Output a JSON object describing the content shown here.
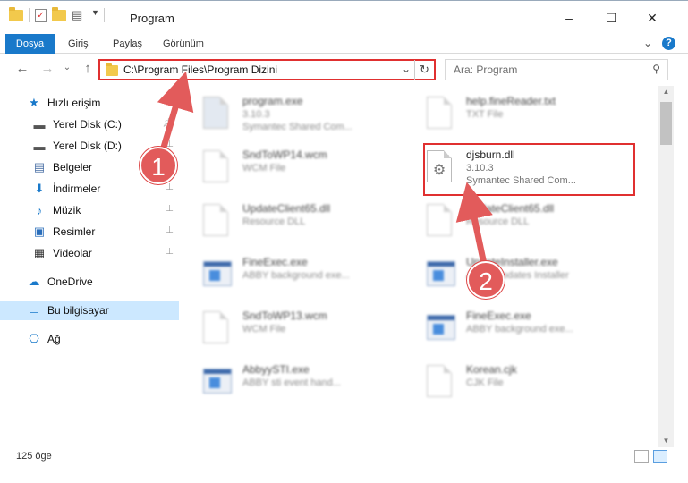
{
  "window": {
    "title": "Program",
    "minimize": "–",
    "maximize": "☐",
    "close": "✕"
  },
  "ribbon": {
    "tabs": [
      "Dosya",
      "Giriş",
      "Paylaş",
      "Görünüm"
    ],
    "help": "?",
    "collapse": "⌄"
  },
  "address": {
    "path": "C:\\Program Files\\Program Dizini",
    "dropdown": "⌄",
    "refresh": "↻"
  },
  "search": {
    "placeholder": "Ara: Program",
    "icon": "search-icon"
  },
  "nav": {
    "back": "←",
    "forward": "→",
    "recent": "⌄",
    "up": "↑"
  },
  "sidebar": {
    "items": [
      {
        "label": "Hızlı erişim",
        "icon": "star-icon",
        "glyph": "★",
        "color": "#1979ca",
        "pinned": false
      },
      {
        "label": "Yerel Disk (C:)",
        "icon": "drive-icon",
        "glyph": "▬",
        "color": "#555555",
        "pinned": true
      },
      {
        "label": "Yerel Disk (D:)",
        "icon": "drive-icon",
        "glyph": "▬",
        "color": "#555555",
        "pinned": true
      },
      {
        "label": "Belgeler",
        "icon": "documents-icon",
        "glyph": "▤",
        "color": "#4a6fa5",
        "pinned": true
      },
      {
        "label": "İndirmeler",
        "icon": "download-icon",
        "glyph": "⬇",
        "color": "#1979ca",
        "pinned": true
      },
      {
        "label": "Müzik",
        "icon": "music-icon",
        "glyph": "♪",
        "color": "#1979ca",
        "pinned": true
      },
      {
        "label": "Resimler",
        "icon": "pictures-icon",
        "glyph": "▣",
        "color": "#2a6ebb",
        "pinned": true
      },
      {
        "label": "Videolar",
        "icon": "video-icon",
        "glyph": "▦",
        "color": "#333333",
        "pinned": true
      },
      {
        "label": "OneDrive",
        "icon": "cloud-icon",
        "glyph": "☁",
        "color": "#1979ca",
        "pinned": false
      },
      {
        "label": "Bu bilgisayar",
        "icon": "computer-icon",
        "glyph": "▭",
        "color": "#1979ca",
        "pinned": false
      },
      {
        "label": "Ağ",
        "icon": "network-icon",
        "glyph": "⎔",
        "color": "#1979ca",
        "pinned": false
      }
    ]
  },
  "files": [
    {
      "name": "program.exe",
      "line2": "3.10.3",
      "line3": "Symantec Shared Com...",
      "icon": "installer-icon"
    },
    {
      "name": "help.fineReader.txt",
      "line2": "TXT File",
      "line3": "",
      "icon": "text-file-icon"
    },
    {
      "name": "SndToWP14.wcm",
      "line2": "WCM File",
      "line3": "",
      "icon": "file-icon"
    },
    {
      "name": "djsburn.dll",
      "line2": "3.10.3",
      "line3": "Symantec Shared Com...",
      "icon": "dll-gear-icon"
    },
    {
      "name": "UpdateClient65.dll",
      "line2": "Resource DLL",
      "line3": "",
      "icon": "dll-gear-icon"
    },
    {
      "name": "UpdateClient65.dll",
      "line2": "Resource DLL",
      "line3": "",
      "icon": "dll-gear-icon"
    },
    {
      "name": "FineExec.exe",
      "line2": "ABBY background exe...",
      "line3": "",
      "icon": "app-window-icon"
    },
    {
      "name": "UpdateInstaller.exe",
      "line2": "ABBY Updates Installer",
      "line3": "",
      "icon": "app-window-icon"
    },
    {
      "name": "SndToWP13.wcm",
      "line2": "WCM File",
      "line3": "",
      "icon": "file-icon"
    },
    {
      "name": "FineExec.exe",
      "line2": "ABBY background exe...",
      "line3": "",
      "icon": "app-window-icon"
    },
    {
      "name": "AbbyySTI.exe",
      "line2": "ABBY sti event hand...",
      "line3": "",
      "icon": "app-window-icon"
    },
    {
      "name": "Korean.cjk",
      "line2": "CJK File",
      "line3": "",
      "icon": "file-icon"
    }
  ],
  "status": {
    "count": "125 öge"
  },
  "annotations": {
    "step1": "1",
    "step2": "2",
    "accent": "#e03030"
  }
}
